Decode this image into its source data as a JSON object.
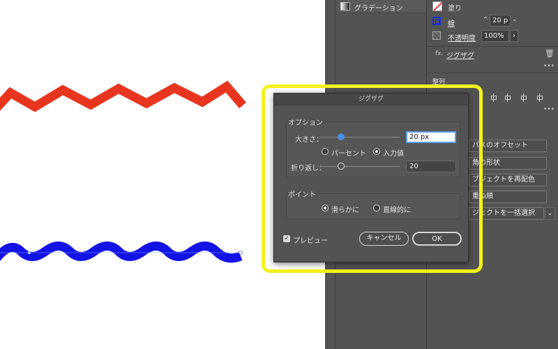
{
  "colors": {
    "red_zigzag": "#e8351f",
    "blue_wave": "#1313e6",
    "highlight": "#f4f21b",
    "panel_bg": "#535353",
    "slider_knob": "#4a8fe0"
  },
  "middle_panel": {
    "gradient_label": "グラデーション",
    "gradient_icon": "gradient-icon"
  },
  "properties": {
    "fill_label": "塗り",
    "stroke_label": "線",
    "stroke_weight": "20 p",
    "opacity_label": "不透明度",
    "opacity_value": "100%",
    "effect_prefix": "fx.",
    "effect_name": "ジグザグ",
    "align_label": "整列",
    "quick_actions": [
      "パスのオフセット",
      "角の形状",
      "ブジェクトを再配色",
      "重ね順",
      "ジェクトを一括選択"
    ]
  },
  "dialog": {
    "title": "ジグザグ",
    "options_group": "オプション",
    "size_label": "大きさ：",
    "size_value": "20 px",
    "percent_label": "パーセント",
    "absolute_label": "入力値",
    "ridges_label": "折り返し：",
    "ridges_value": "20",
    "points_group": "ポイント",
    "smooth_label": "滑らかに",
    "corner_label": "直線的に",
    "preview_label": "プレビュー",
    "cancel_label": "キャンセル",
    "ok_label": "OK",
    "size_is_absolute": true,
    "points_smooth": true,
    "preview_checked": true
  }
}
